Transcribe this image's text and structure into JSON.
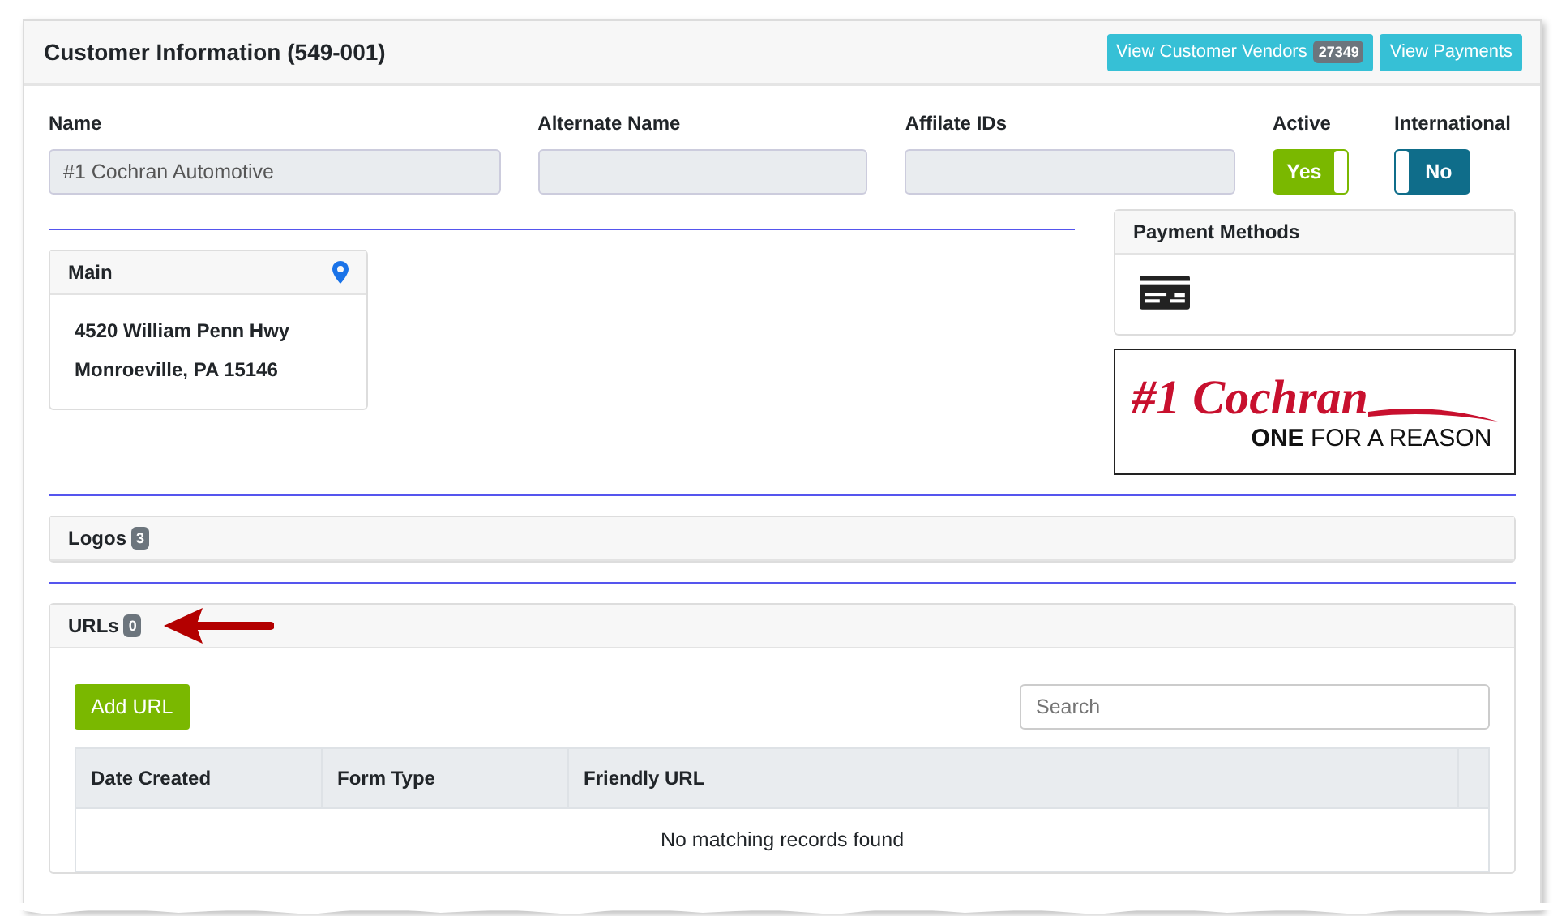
{
  "card": {
    "title": "Customer Information (549-001)",
    "buttons": [
      {
        "label": "View Customer Vendors",
        "badge": "27349"
      },
      {
        "label": "View Payments"
      }
    ]
  },
  "fields": [
    {
      "label": "Name",
      "value": "#1 Cochran Automotive"
    },
    {
      "label": "Alternate Name"
    },
    {
      "label": "Affilate IDs"
    }
  ],
  "toggles": [
    {
      "label": "Active",
      "text": "Yes",
      "on": true
    },
    {
      "label": "International",
      "text": "No",
      "on": false
    }
  ],
  "address": {
    "title": "Main",
    "lines": [
      "4520 William Penn Hwy",
      "Monroeville, PA 15146"
    ]
  },
  "payment_methods": {
    "title": "Payment Methods"
  },
  "logo": {
    "headline": "#1 Cochran",
    "tagline": "**ONE** FOR A REASON"
  },
  "sections": [
    {
      "title": "Logos",
      "count": "3",
      "expanded": false
    },
    {
      "title": "URLs",
      "count": "0",
      "expanded": true,
      "annotated": true
    }
  ],
  "urls": {
    "add_button": "Add URL",
    "search": {
      "placeholder": "Search"
    },
    "columns": [
      "Date Created",
      "Form Type",
      "Friendly URL"
    ],
    "empty_message": "No matching records found"
  }
}
